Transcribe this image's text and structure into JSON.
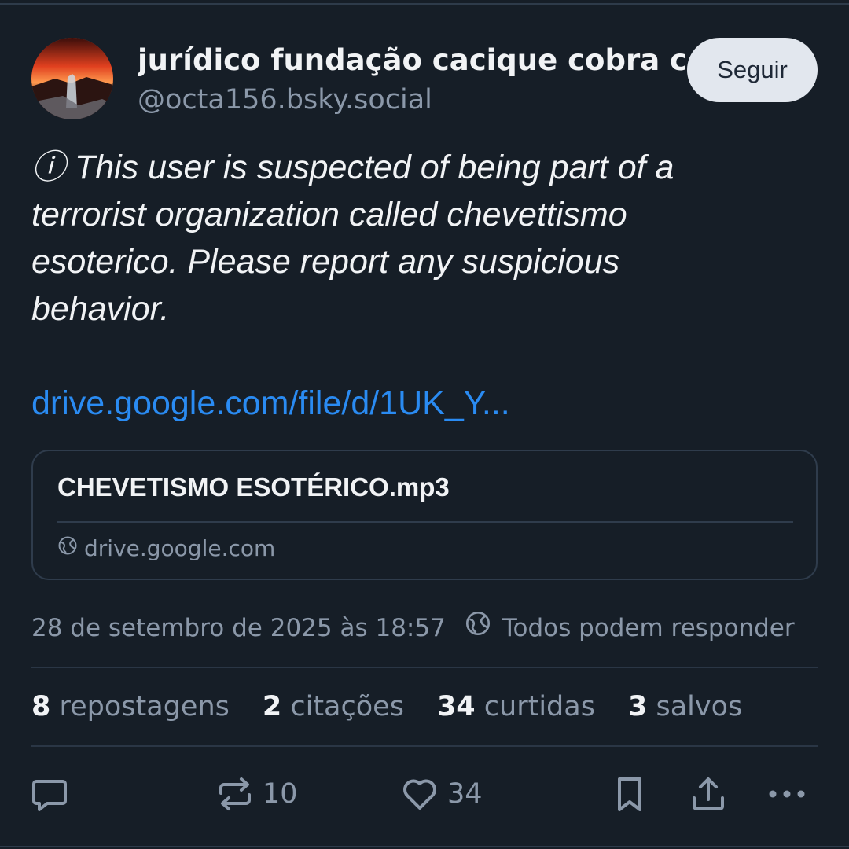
{
  "header": {
    "display_name": "jurídico fundação cacique cobra co",
    "handle": "@octa156.bsky.social",
    "follow_label": "Seguir"
  },
  "post": {
    "text": "ⓘ This user is suspected of being part of a\nterrorist organization called chevettismo\nesoterico. Please report any suspicious\nbehavior.",
    "link_text": "drive.google.com/file/d/1UK_Y..."
  },
  "link_card": {
    "title": "CHEVETISMO ESOTÉRICO.mp3",
    "domain": "drive.google.com",
    "domain_icon": "globe-icon"
  },
  "meta": {
    "timestamp": "28 de setembro de 2025 às 18:57",
    "reply_setting": "Todos podem responder",
    "reply_icon": "globe-icon"
  },
  "stats": {
    "reposts": {
      "count": "8",
      "label": "repostagens"
    },
    "quotes": {
      "count": "2",
      "label": "citações"
    },
    "likes": {
      "count": "34",
      "label": "curtidas"
    },
    "saves": {
      "count": "3",
      "label": "salvos"
    }
  },
  "actions": {
    "reply_icon": "speech-bubble-icon",
    "repost_icon": "repost-icon",
    "repost_count": "10",
    "like_icon": "heart-icon",
    "like_count": "34",
    "bookmark_icon": "bookmark-icon",
    "share_icon": "share-icon",
    "more_icon": "ellipsis-icon"
  },
  "colors": {
    "background": "#161e27",
    "link": "#2a8bf2",
    "muted_text": "#8b98a9",
    "follow_button_bg": "#e2e7ee"
  }
}
